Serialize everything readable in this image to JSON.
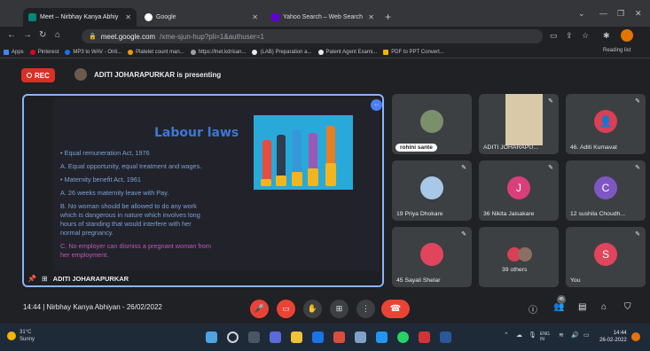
{
  "browser": {
    "tabs": [
      {
        "label": "Meet – Nirbhay Kanya Abhiy",
        "active": true
      },
      {
        "label": "Google",
        "active": false
      },
      {
        "label": "Yahoo Search – Web Search",
        "active": false
      }
    ],
    "url_main": "meet.google.com",
    "url_rest": "/xme-sjun-hup?pli=1&authuser=1",
    "bookmarks": [
      "Apps",
      "Pinterest",
      "MP3 to WAV - Onli...",
      "Platelet count man...",
      "https://lnet.kdrisan...",
      "(LAB) Preparation a...",
      "Patent Agent Exami...",
      "PDF to PPT Convert..."
    ],
    "reading_list": "Reading list"
  },
  "meet": {
    "rec_label": "REC",
    "presenting_text": "ADITI JOHARAPURKAR is presenting",
    "presenter_name": "ADITI JOHARAPURKAR",
    "meeting_info": "14:44  |  Nirbhay Kanya Abhiyan - 26/02/2022",
    "participants_count": "45"
  },
  "slide": {
    "title": "Labour laws",
    "lines": [
      "•  Equal remuneration Act, 1976",
      "A.  Equal opportunity, equal treatment and wages.",
      "•  Maternity benefit Act, 1961",
      "A.  26 weeks maternity leave with Pay.",
      "B.  No woman should be allowed to do any work",
      "     which is dangerous in nature which involves long",
      "     hours of standing that would interfere with her",
      "     normal pregnancy.",
      "C.  No employer can dismiss a pregnant woman from",
      "     her employment."
    ]
  },
  "participants": [
    {
      "name": "rohini sante",
      "type": "photo",
      "color": "#7a8f6a"
    },
    {
      "name": "ADITI JOHARAPU...",
      "type": "camera",
      "color": "#d8c9a8"
    },
    {
      "name": "46. Aditi Kumavat",
      "type": "letter",
      "letter": "",
      "color": "#d93f55"
    },
    {
      "name": "19 Priya Dhokare",
      "type": "photo",
      "color": "#a8c8e8"
    },
    {
      "name": "36 Nikita Jaisakare",
      "type": "letter",
      "letter": "J",
      "color": "#d93f79"
    },
    {
      "name": "12 sushila Choudh...",
      "type": "letter",
      "letter": "C",
      "color": "#7e57c2"
    },
    {
      "name": "45 Sayali Shelar",
      "type": "photo",
      "color": "#e0455c"
    },
    {
      "name": "39 others",
      "type": "others",
      "color": "#d93f55"
    },
    {
      "name": "You",
      "type": "letter",
      "letter": "S",
      "color": "#e0455c"
    }
  ],
  "taskbar": {
    "weather_temp": "31°C",
    "weather_desc": "Sunny",
    "lang": "ENG",
    "lang2": "IN",
    "time": "14:44",
    "date": "26-02-2022"
  }
}
